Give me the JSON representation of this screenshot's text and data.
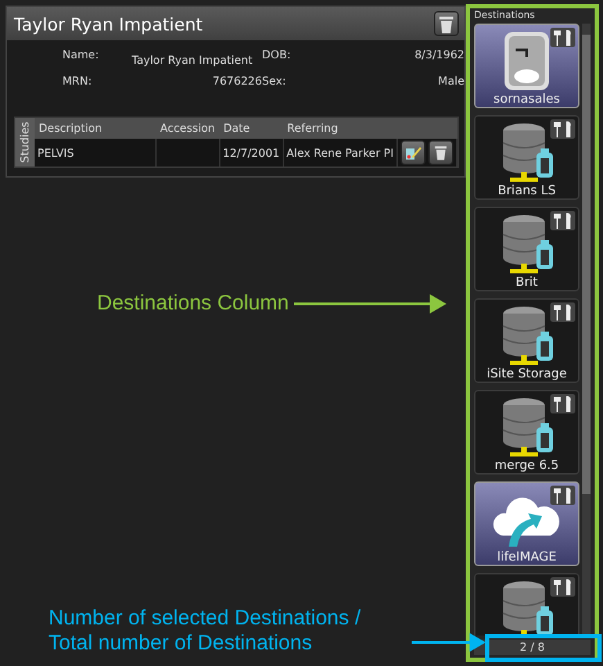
{
  "patient": {
    "title": "Taylor Ryan Impatient",
    "fields": [
      {
        "label": "Name:",
        "value": "Taylor Ryan Impatient"
      },
      {
        "label": "DOB:",
        "value": "8/3/1962"
      },
      {
        "label": "MRN:",
        "value": "7676226"
      },
      {
        "label": "Sex:",
        "value": "Male"
      }
    ],
    "studies_tab": "Studies",
    "columns": [
      "Description",
      "Accession",
      "Date",
      "Referring"
    ],
    "rows": [
      {
        "description": "PELVIS",
        "accession": "",
        "date": "12/7/2001",
        "referring": "Alex Rene Parker PI"
      }
    ]
  },
  "destinations": {
    "title": "Destinations",
    "items": [
      {
        "kind": "drive",
        "label": "sornasales",
        "selected": true
      },
      {
        "kind": "server",
        "label": "Brians LS",
        "selected": false
      },
      {
        "kind": "server",
        "label": "Brit",
        "selected": false
      },
      {
        "kind": "server",
        "label": "iSite Storage",
        "selected": false
      },
      {
        "kind": "server",
        "label": "merge 6.5",
        "selected": false
      },
      {
        "kind": "cloud",
        "label": "lifeIMAGE",
        "selected": true
      },
      {
        "kind": "server",
        "selected": false
      }
    ],
    "count": "2 / 8"
  },
  "annotations": [
    {
      "kind": "green",
      "text": "Destinations Column"
    },
    {
      "kind": "blue",
      "text": "Number of selected Destinations / Total number of Destinations"
    }
  ]
}
